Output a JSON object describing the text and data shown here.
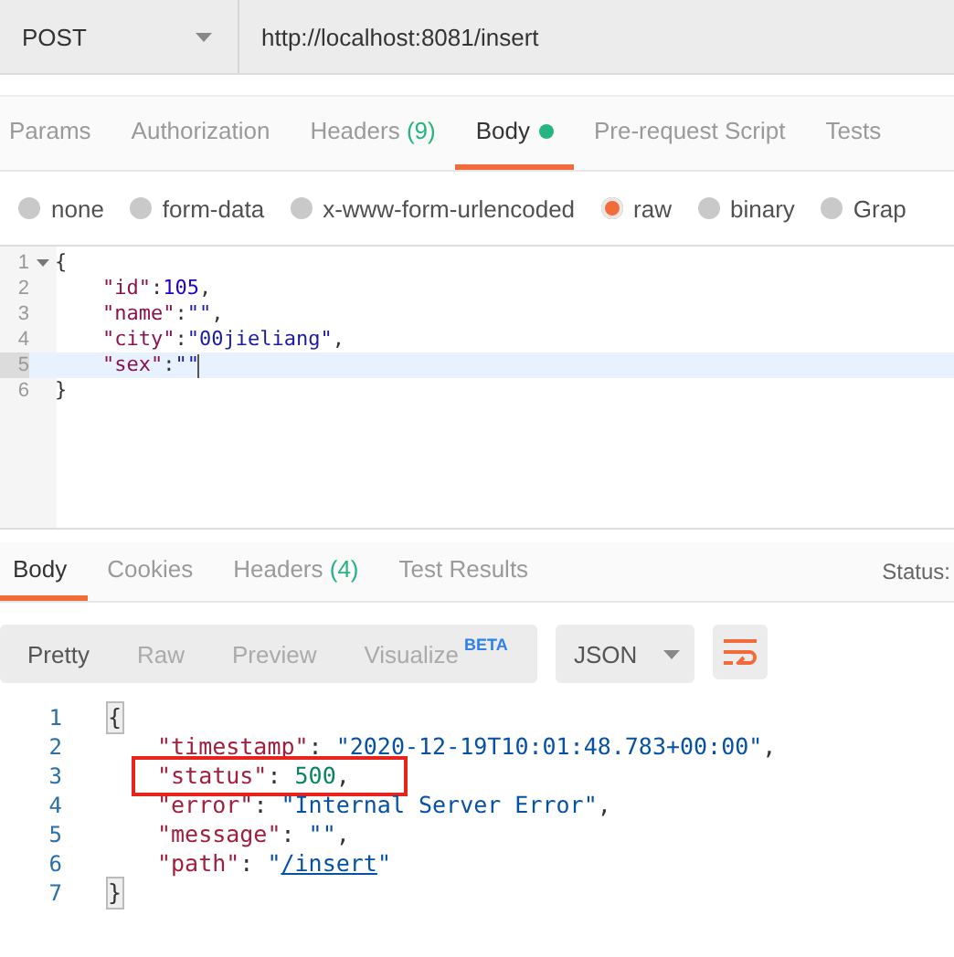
{
  "request": {
    "method": "POST",
    "url": "http://localhost:8081/insert"
  },
  "request_tabs": [
    {
      "label": "Params",
      "selected": false
    },
    {
      "label": "Authorization",
      "selected": false
    },
    {
      "label": "Headers",
      "count": "(9)",
      "selected": false
    },
    {
      "label": "Body",
      "selected": true,
      "has_content": true
    },
    {
      "label": "Pre-request Script",
      "selected": false
    },
    {
      "label": "Tests",
      "selected": false
    }
  ],
  "body_types": [
    {
      "label": "none",
      "selected": false
    },
    {
      "label": "form-data",
      "selected": false
    },
    {
      "label": "x-www-form-urlencoded",
      "selected": false
    },
    {
      "label": "raw",
      "selected": true
    },
    {
      "label": "binary",
      "selected": false
    },
    {
      "label": "Grap",
      "selected": false
    }
  ],
  "request_body": [
    {
      "number": "1",
      "active": false,
      "indented": false,
      "foldable": true,
      "tokens": [
        {
          "kind": "punct",
          "text": "{"
        }
      ]
    },
    {
      "number": "2",
      "active": false,
      "indented": true,
      "tokens": [
        {
          "kind": "key",
          "text": "\"id\""
        },
        {
          "kind": "punct",
          "text": ":"
        },
        {
          "kind": "number",
          "text": "105"
        },
        {
          "kind": "punct",
          "text": ","
        }
      ]
    },
    {
      "number": "3",
      "active": false,
      "indented": true,
      "tokens": [
        {
          "kind": "key",
          "text": "\"name\""
        },
        {
          "kind": "punct",
          "text": ":"
        },
        {
          "kind": "string",
          "text": "\"\""
        },
        {
          "kind": "punct",
          "text": ","
        }
      ]
    },
    {
      "number": "4",
      "active": false,
      "indented": true,
      "tokens": [
        {
          "kind": "key",
          "text": "\"city\""
        },
        {
          "kind": "punct",
          "text": ":"
        },
        {
          "kind": "string",
          "text": "\"00jieliang\""
        },
        {
          "kind": "punct",
          "text": ","
        }
      ]
    },
    {
      "number": "5",
      "active": true,
      "indented": true,
      "tokens": [
        {
          "kind": "key",
          "text": "\"sex\""
        },
        {
          "kind": "punct",
          "text": ":"
        },
        {
          "kind": "string",
          "text": "\"\""
        }
      ]
    },
    {
      "number": "6",
      "active": false,
      "indented": false,
      "tokens": [
        {
          "kind": "punct",
          "text": "}"
        }
      ]
    }
  ],
  "response_tabs": [
    {
      "label": "Body",
      "selected": true
    },
    {
      "label": "Cookies",
      "selected": false
    },
    {
      "label": "Headers",
      "count": "(4)",
      "selected": false
    },
    {
      "label": "Test Results",
      "selected": false
    }
  ],
  "response_status": {
    "label": "Status:"
  },
  "view_modes": [
    {
      "label": "Pretty",
      "selected": true
    },
    {
      "label": "Raw",
      "selected": false
    },
    {
      "label": "Preview",
      "selected": false
    },
    {
      "label": "Visualize",
      "badge": "BETA",
      "selected": false
    }
  ],
  "format": "JSON",
  "response_body": [
    {
      "number": "1",
      "indented": false,
      "bracket_match": true,
      "boxed": false,
      "tokens": [
        {
          "kind": "punct",
          "text": "{"
        }
      ]
    },
    {
      "number": "2",
      "indented": true,
      "bracket_match": false,
      "boxed": false,
      "tokens": [
        {
          "kind": "key",
          "text": "\"timestamp\""
        },
        {
          "kind": "punct",
          "text": ": "
        },
        {
          "kind": "string",
          "text": "\"2020-12-19T10:01:48.783+00:00\""
        },
        {
          "kind": "punct",
          "text": ","
        }
      ]
    },
    {
      "number": "3",
      "indented": true,
      "bracket_match": false,
      "boxed": true,
      "tokens": [
        {
          "kind": "key",
          "text": "\"status\""
        },
        {
          "kind": "punct",
          "text": ": "
        },
        {
          "kind": "number",
          "text": "500"
        },
        {
          "kind": "punct",
          "text": ","
        }
      ]
    },
    {
      "number": "4",
      "indented": true,
      "bracket_match": false,
      "boxed": false,
      "tokens": [
        {
          "kind": "key",
          "text": "\"error\""
        },
        {
          "kind": "punct",
          "text": ": "
        },
        {
          "kind": "string",
          "text": "\"Internal Server Error\""
        },
        {
          "kind": "punct",
          "text": ","
        }
      ]
    },
    {
      "number": "5",
      "indented": true,
      "bracket_match": false,
      "boxed": false,
      "tokens": [
        {
          "kind": "key",
          "text": "\"message\""
        },
        {
          "kind": "punct",
          "text": ": "
        },
        {
          "kind": "string",
          "text": "\"\""
        },
        {
          "kind": "punct",
          "text": ","
        }
      ]
    },
    {
      "number": "6",
      "indented": true,
      "bracket_match": false,
      "boxed": false,
      "tokens": [
        {
          "kind": "key",
          "text": "\"path\""
        },
        {
          "kind": "punct",
          "text": ": "
        },
        {
          "kind": "string",
          "text": "\""
        },
        {
          "kind": "link",
          "text": "/insert"
        },
        {
          "kind": "string",
          "text": "\""
        }
      ]
    },
    {
      "number": "7",
      "indented": false,
      "bracket_match": true,
      "boxed": false,
      "tokens": [
        {
          "kind": "punct",
          "text": "}"
        }
      ]
    }
  ]
}
